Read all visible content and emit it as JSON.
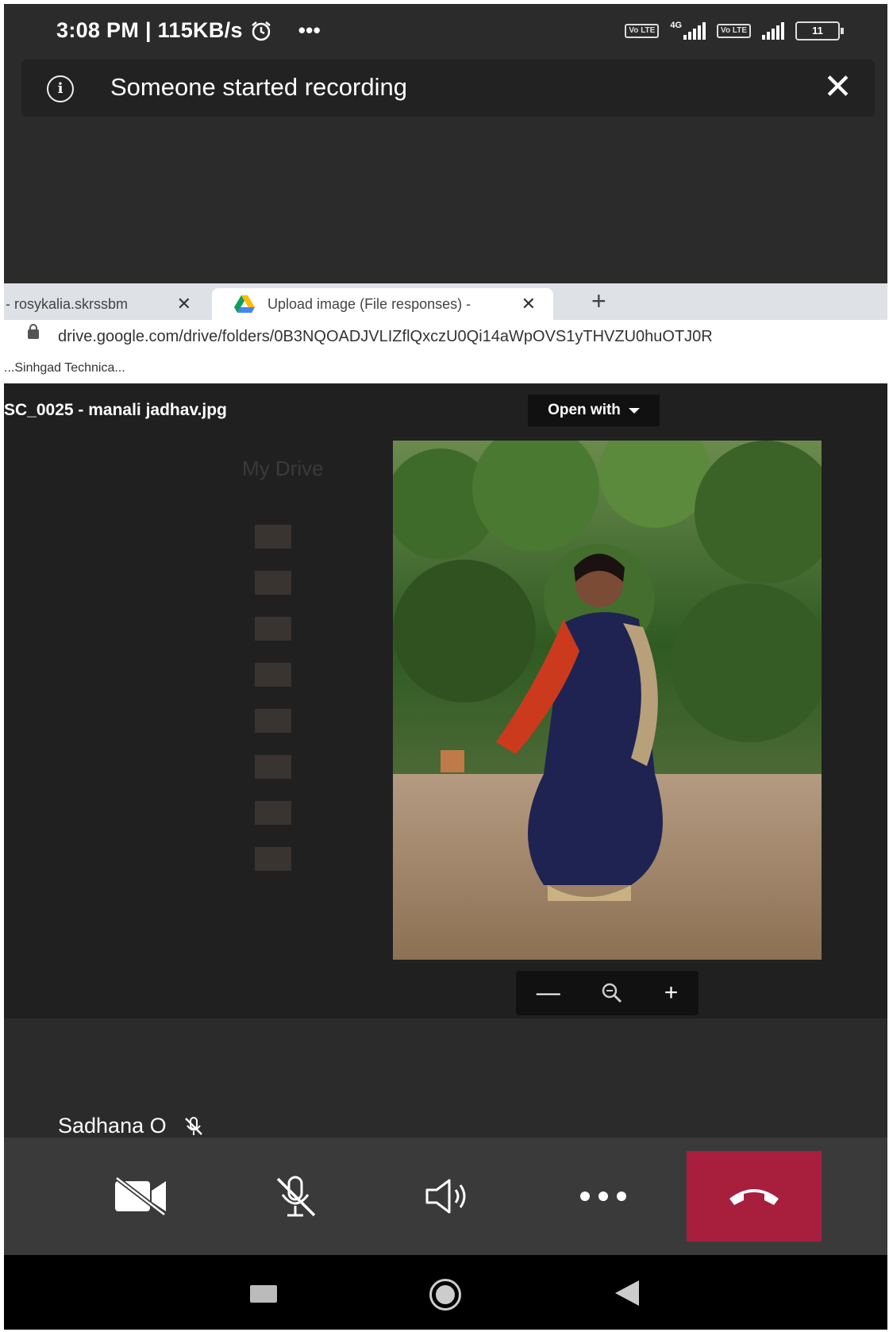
{
  "status_bar": {
    "time_speed": "3:08 PM | 115KB/s",
    "network_label": "4G",
    "volte_label": "Vo LTE",
    "battery_level": "11"
  },
  "banner": {
    "message": "Someone started recording"
  },
  "browser": {
    "tab_inactive_label": "- rosykalia.skrssbm",
    "tab_active_label": "Upload image (File responses) -",
    "url": "drive.google.com/drive/folders/0B3NQOADJVLIZflQxczU0Qi14aWpOVS1yTHVZU0huOTJ0R",
    "bookmark_label": "...Sinhgad Technica..."
  },
  "viewer": {
    "file_title": "SC_0025 - manali jadhav.jpg",
    "open_with_label": "Open with",
    "background_breadcrumb": "My Drive",
    "zoom_controls": [
      "zoom-out",
      "zoom-reset",
      "zoom-in"
    ]
  },
  "call": {
    "participant_name": "Sadhana O",
    "controls": [
      "camera-off",
      "mic-off",
      "speaker",
      "more",
      "end-call"
    ],
    "end_call_color": "#a81f3d"
  }
}
